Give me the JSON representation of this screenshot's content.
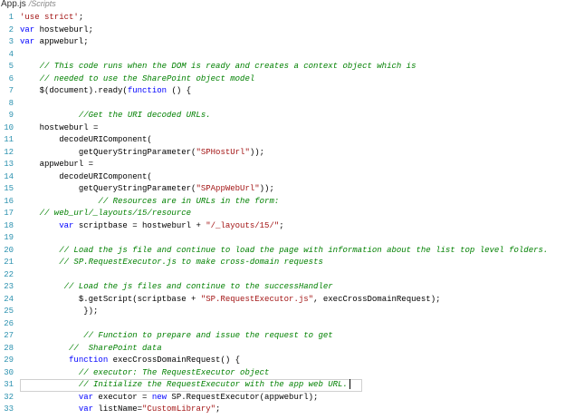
{
  "tab": {
    "file": "App.js",
    "path": "/Scripts"
  },
  "lines": [
    {
      "n": "1",
      "indent": 0,
      "t": [
        [
          "str",
          "'use strict'"
        ],
        [
          "",
          "; "
        ]
      ]
    },
    {
      "n": "2",
      "indent": 0,
      "t": [
        [
          "kw",
          "var"
        ],
        [
          "",
          " hostweburl;"
        ]
      ]
    },
    {
      "n": "3",
      "indent": 0,
      "t": [
        [
          "kw",
          "var"
        ],
        [
          "",
          " appweburl;"
        ]
      ]
    },
    {
      "n": "4",
      "indent": 0,
      "t": []
    },
    {
      "n": "5",
      "indent": 4,
      "t": [
        [
          "cm",
          "// This code runs when the DOM is ready and creates a context object which is"
        ]
      ]
    },
    {
      "n": "6",
      "indent": 4,
      "t": [
        [
          "cm",
          "// needed to use the SharePoint object model"
        ]
      ]
    },
    {
      "n": "7",
      "indent": 4,
      "t": [
        [
          "",
          "$(document).ready("
        ],
        [
          "kw",
          "function"
        ],
        [
          "",
          " () {"
        ]
      ]
    },
    {
      "n": "8",
      "indent": 0,
      "t": []
    },
    {
      "n": "9",
      "indent": 12,
      "t": [
        [
          "cm",
          "//Get the URI decoded URLs."
        ]
      ]
    },
    {
      "n": "10",
      "indent": 4,
      "t": [
        [
          "",
          "hostweburl ="
        ]
      ]
    },
    {
      "n": "11",
      "indent": 8,
      "t": [
        [
          "",
          "decodeURIComponent("
        ]
      ]
    },
    {
      "n": "12",
      "indent": 12,
      "t": [
        [
          "",
          "getQueryStringParameter("
        ],
        [
          "str",
          "\"SPHostUrl\""
        ],
        [
          "",
          "));"
        ]
      ]
    },
    {
      "n": "13",
      "indent": 4,
      "t": [
        [
          "",
          "appweburl ="
        ]
      ]
    },
    {
      "n": "14",
      "indent": 8,
      "t": [
        [
          "",
          "decodeURIComponent("
        ]
      ]
    },
    {
      "n": "15",
      "indent": 12,
      "t": [
        [
          "",
          "getQueryStringParameter("
        ],
        [
          "str",
          "\"SPAppWebUrl\""
        ],
        [
          "",
          "));"
        ]
      ]
    },
    {
      "n": "16",
      "indent": 16,
      "t": [
        [
          "cm",
          "// Resources are in URLs in the form:"
        ]
      ]
    },
    {
      "n": "17",
      "indent": 4,
      "t": [
        [
          "cm",
          "// web_url/_layouts/15/resource"
        ]
      ]
    },
    {
      "n": "18",
      "indent": 8,
      "t": [
        [
          "kw",
          "var"
        ],
        [
          "",
          " scriptbase = hostweburl + "
        ],
        [
          "str",
          "\"/_layouts/15/\""
        ],
        [
          "",
          ";"
        ]
      ]
    },
    {
      "n": "19",
      "indent": 0,
      "t": []
    },
    {
      "n": "20",
      "indent": 8,
      "t": [
        [
          "cm",
          "// Load the js file and continue to load the page with information about the list top level folders."
        ]
      ]
    },
    {
      "n": "21",
      "indent": 8,
      "t": [
        [
          "cm",
          "// SP.RequestExecutor.js to make cross-domain requests"
        ]
      ]
    },
    {
      "n": "22",
      "indent": 0,
      "t": []
    },
    {
      "n": "23",
      "indent": 9,
      "t": [
        [
          "cm",
          "// Load the js files and continue to the successHandler"
        ]
      ]
    },
    {
      "n": "24",
      "indent": 12,
      "t": [
        [
          "",
          "$.getScript(scriptbase + "
        ],
        [
          "str",
          "\"SP.RequestExecutor.js\""
        ],
        [
          "",
          ", execCrossDomainRequest);"
        ]
      ]
    },
    {
      "n": "25",
      "indent": 13,
      "t": [
        [
          "",
          "});"
        ]
      ]
    },
    {
      "n": "26",
      "indent": 0,
      "t": []
    },
    {
      "n": "27",
      "indent": 13,
      "t": [
        [
          "cm",
          "// Function to prepare and issue the request to get"
        ]
      ]
    },
    {
      "n": "28",
      "indent": 10,
      "t": [
        [
          "cm",
          "//  SharePoint data"
        ]
      ]
    },
    {
      "n": "29",
      "indent": 10,
      "t": [
        [
          "kw",
          "function"
        ],
        [
          "",
          " execCrossDomainRequest() {"
        ]
      ]
    },
    {
      "n": "30",
      "indent": 12,
      "t": [
        [
          "cm",
          "// executor: The RequestExecutor object"
        ]
      ]
    },
    {
      "n": "31",
      "indent": 12,
      "current": true,
      "t": [
        [
          "cm",
          "// Initialize the RequestExecutor with the app web URL."
        ]
      ]
    },
    {
      "n": "32",
      "indent": 12,
      "t": [
        [
          "kw",
          "var"
        ],
        [
          "",
          " executor = "
        ],
        [
          "kw",
          "new"
        ],
        [
          "",
          " SP.RequestExecutor(appweburl);"
        ]
      ]
    },
    {
      "n": "33",
      "indent": 12,
      "t": [
        [
          "kw",
          "var"
        ],
        [
          "",
          " listName="
        ],
        [
          "str",
          "\"CustomLibrary\""
        ],
        [
          "",
          ";"
        ]
      ]
    }
  ]
}
